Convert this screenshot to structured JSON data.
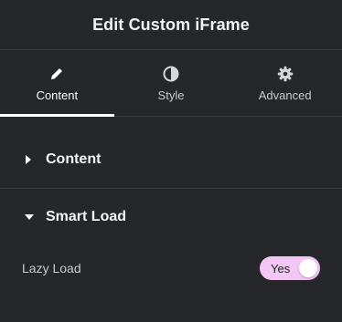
{
  "header": {
    "title": "Edit Custom iFrame"
  },
  "tabs": [
    {
      "label": "Content",
      "icon": "pencil-icon",
      "active": true
    },
    {
      "label": "Style",
      "icon": "contrast-icon",
      "active": false
    },
    {
      "label": "Advanced",
      "icon": "gear-icon",
      "active": false
    }
  ],
  "sections": [
    {
      "title": "Content",
      "state": "collapsed",
      "icon": "caret-right-icon"
    },
    {
      "title": "Smart Load",
      "state": "expanded",
      "icon": "caret-down-icon"
    }
  ],
  "controls": {
    "lazy_load": {
      "label": "Lazy Load",
      "value_label": "Yes",
      "checked": true
    }
  },
  "colors": {
    "background": "#26272b",
    "divider": "#3a3b3f",
    "switch_on": "#f3c6f5",
    "text": "#e6e8ea"
  }
}
